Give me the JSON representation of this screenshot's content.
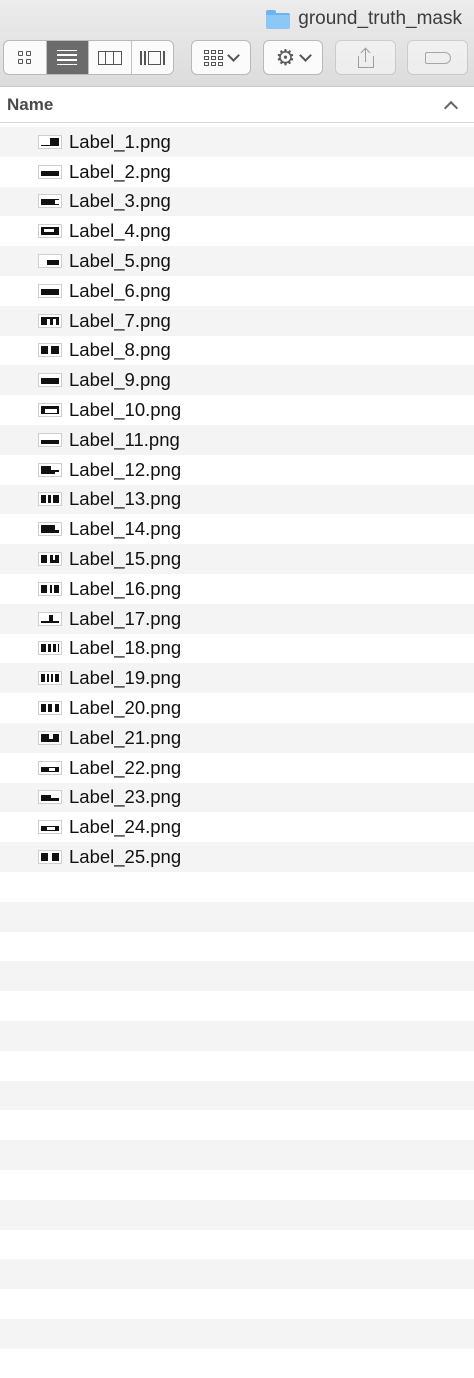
{
  "window": {
    "folder_name": "ground_truth_mask"
  },
  "toolbar": {
    "view_buttons": [
      {
        "name": "icon-view",
        "active": false
      },
      {
        "name": "list-view",
        "active": true
      },
      {
        "name": "column-view",
        "active": false
      },
      {
        "name": "cover-flow-view",
        "active": false
      }
    ],
    "arrange_icon": "arrange-grid-icon",
    "action_icon": "gear-icon",
    "share_icon": "share-icon",
    "tags_icon": "tag-icon"
  },
  "columns": {
    "name_header": "Name",
    "sort": "ascending"
  },
  "files": [
    "Label_1.png",
    "Label_2.png",
    "Label_3.png",
    "Label_4.png",
    "Label_5.png",
    "Label_6.png",
    "Label_7.png",
    "Label_8.png",
    "Label_9.png",
    "Label_10.png",
    "Label_11.png",
    "Label_12.png",
    "Label_13.png",
    "Label_14.png",
    "Label_15.png",
    "Label_16.png",
    "Label_17.png",
    "Label_18.png",
    "Label_19.png",
    "Label_20.png",
    "Label_21.png",
    "Label_22.png",
    "Label_23.png",
    "Label_24.png",
    "Label_25.png"
  ],
  "colors": {
    "stripe": "#f4f4f4",
    "active_segment": "#6b6b6b",
    "folder": "#8cc8f6"
  }
}
